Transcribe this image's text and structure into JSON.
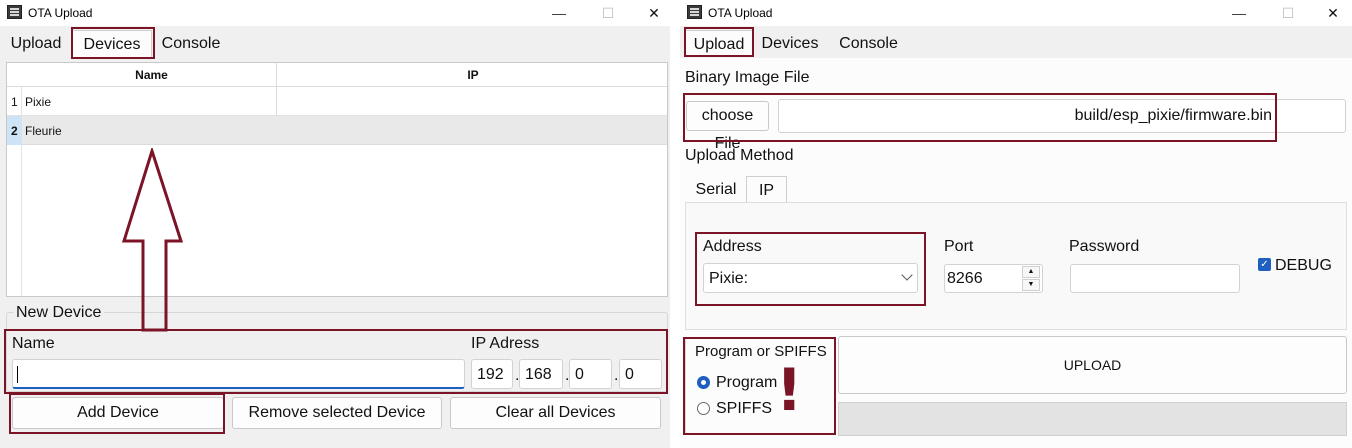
{
  "left_window": {
    "title": "OTA Upload",
    "controls": {
      "minimize": "—",
      "maximize": "☐",
      "close": "✕"
    },
    "tabs": [
      "Upload",
      "Devices",
      "Console"
    ],
    "active_tab": "Devices",
    "table": {
      "columns": [
        "Name",
        "IP"
      ],
      "rows": [
        {
          "num": "1",
          "name": "Pixie",
          "ip": ""
        },
        {
          "num": "2",
          "name": "Fleurie",
          "ip": ""
        }
      ]
    },
    "new_device": {
      "group_title": "New Device",
      "name_label": "Name",
      "name_value": "",
      "ip_label": "IP Adress",
      "ip_octets": [
        "192",
        "168",
        "0",
        "0"
      ],
      "ip_separator": "."
    },
    "buttons": {
      "add": "Add Device",
      "remove": "Remove selected Device",
      "clear": "Clear all Devices"
    }
  },
  "right_window": {
    "title": "OTA Upload",
    "controls": {
      "minimize": "—",
      "maximize": "☐",
      "close": "✕"
    },
    "tabs": [
      "Upload",
      "Devices",
      "Console"
    ],
    "active_tab": "Upload",
    "binary_label": "Binary Image File",
    "choose_file_label": "choose File",
    "file_path": "build/esp_pixie/firmware.bin",
    "upload_method_label": "Upload Method",
    "method_tabs": [
      "Serial",
      "IP"
    ],
    "active_method_tab": "IP",
    "address": {
      "label": "Address",
      "selected": "Pixie:"
    },
    "port": {
      "label": "Port",
      "value": "8266"
    },
    "password": {
      "label": "Password",
      "value": ""
    },
    "debug": {
      "label": "DEBUG",
      "checked": true
    },
    "program_group": {
      "title": "Program or SPIFFS",
      "options": [
        "Program",
        "SPIFFS"
      ],
      "selected": "Program"
    },
    "upload_button": "UPLOAD",
    "annotation_mark": "!"
  },
  "colors": {
    "highlight": "#7b1426",
    "checkbox_accent": "#1e5fbf",
    "radio_accent": "#1e5fbf"
  }
}
